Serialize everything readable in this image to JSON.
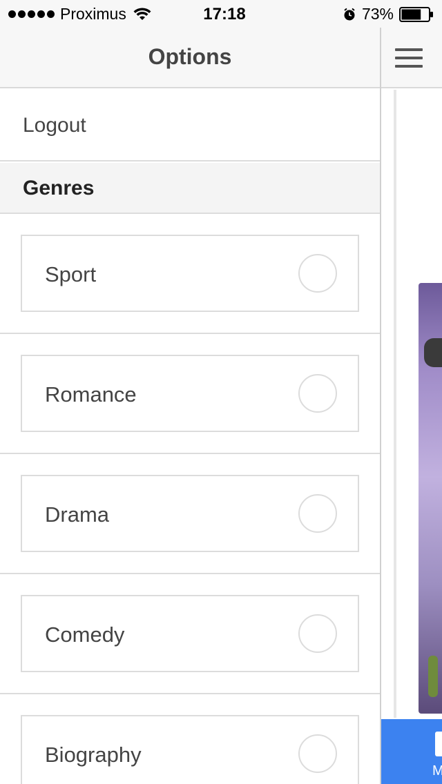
{
  "status_bar": {
    "carrier": "Proximus",
    "time": "17:18",
    "battery_percent": "73%",
    "signal_bars": 5,
    "battery_level": 0.73
  },
  "options_panel": {
    "title": "Options",
    "logout_label": "Logout",
    "genres_header": "Genres",
    "genres": [
      {
        "label": "Sport",
        "selected": false
      },
      {
        "label": "Romance",
        "selected": false
      },
      {
        "label": "Drama",
        "selected": false
      },
      {
        "label": "Comedy",
        "selected": false
      },
      {
        "label": "Biography",
        "selected": false
      }
    ]
  },
  "main_view": {
    "menu_icon": "hamburger-menu-icon",
    "tab_label_partial": "M",
    "accent_color": "#3c82f0"
  }
}
